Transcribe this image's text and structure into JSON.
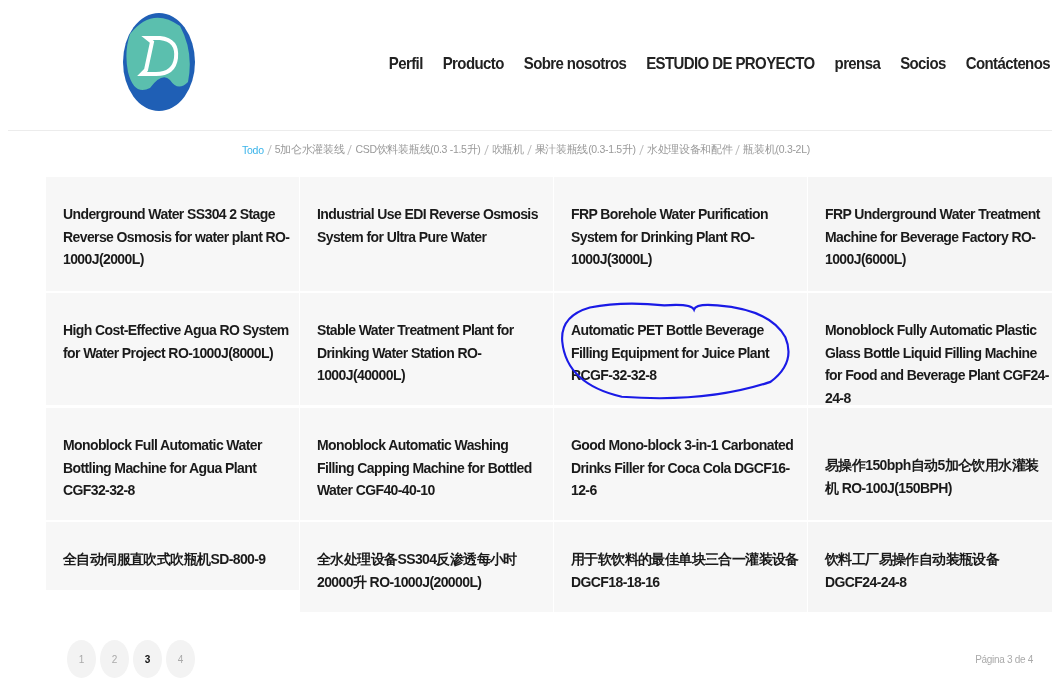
{
  "nav": [
    {
      "label": "Perfil"
    },
    {
      "label": "Producto"
    },
    {
      "label": "Sobre nosotros"
    },
    {
      "label": "ESTUDIO DE PROYECTO"
    },
    {
      "label": "prensa"
    },
    {
      "label": "Socios"
    },
    {
      "label": "Contáctenos"
    }
  ],
  "breadcrumb": [
    {
      "label": "Todo",
      "selected": true
    },
    {
      "label": "5加仑水灌装线",
      "selected": false
    },
    {
      "label": "CSD饮料装瓶线(0.3 -1.5升)",
      "selected": false
    },
    {
      "label": "吹瓶机",
      "selected": false
    },
    {
      "label": "果汁装瓶线(0.3-1.5升)",
      "selected": false
    },
    {
      "label": "水处理设备和配件",
      "selected": false
    },
    {
      "label": "瓶装机(0.3-2L)",
      "selected": false
    }
  ],
  "products": [
    {
      "title": "Underground Water SS304 2 Stage Reverse Osmosis for water plant RO-1000J(2000L)",
      "highlighted": false
    },
    {
      "title": "Industrial Use EDI Reverse Osmosis System for Ultra Pure Water",
      "highlighted": false
    },
    {
      "title": "FRP Borehole Water Purification System for Drinking Plant RO-1000J(3000L)",
      "highlighted": false
    },
    {
      "title": "FRP Underground Water Treatment Machine for Beverage Factory RO-1000J(6000L)",
      "highlighted": false
    },
    {
      "title": "High Cost-Effective Agua RO System for Water Project RO-1000J(8000L)",
      "highlighted": false
    },
    {
      "title": "Stable Water Treatment Plant for Drinking Water Station RO-1000J(40000L)",
      "highlighted": false
    },
    {
      "title": "Automatic PET Bottle Beverage Filling Equipment for Juice Plant RCGF-32-32-8",
      "highlighted": true
    },
    {
      "title": "Monoblock Fully Automatic Plastic Glass Bottle Liquid Filling Machine for Food and Beverage Plant CGF24-24-8",
      "highlighted": false
    },
    {
      "title": "Monoblock Full Automatic Water Bottling Machine for Agua Plant CGF32-32-8",
      "highlighted": false
    },
    {
      "title": "Monoblock Automatic Washing Filling Capping Machine for Bottled Water CGF40-40-10",
      "highlighted": false
    },
    {
      "title": "Good Mono-block 3-in-1 Carbonated Drinks Filler for Coca Cola DGCF16-12-6",
      "highlighted": false
    },
    {
      "title": "易操作150bph自动5加仑饮用水灌装机 RO-100J(150BPH)",
      "highlighted": false
    },
    {
      "title": "全自动伺服直吹式吹瓶机SD-800-9",
      "highlighted": false
    },
    {
      "title": "全水处理设备SS304反渗透每小时20000升 RO-1000J(20000L)",
      "highlighted": false
    },
    {
      "title": "用于软饮料的最佳单块三合一灌装设备DGCF18-18-16",
      "highlighted": false
    },
    {
      "title": "饮料工厂易操作自动装瓶设备DGCF24-24-8",
      "highlighted": false
    }
  ],
  "pagination": {
    "pages": [
      {
        "label": "1",
        "selected": false
      },
      {
        "label": "2",
        "selected": false
      },
      {
        "label": "3",
        "selected": true
      },
      {
        "label": "4",
        "selected": false
      }
    ],
    "summary": "Página 3 de 4"
  }
}
